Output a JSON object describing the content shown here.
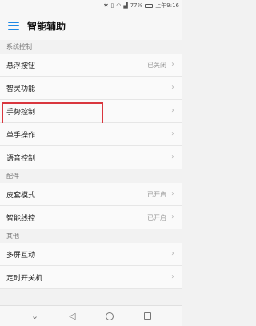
{
  "status_bar": {
    "battery_text": "77%",
    "time": "上午9:16"
  },
  "app_bar": {
    "title": "智能辅助"
  },
  "sections": [
    {
      "header": "系统控制",
      "rows": [
        {
          "label": "悬浮按钮",
          "value": "已关闭"
        },
        {
          "label": "智灵功能",
          "value": ""
        },
        {
          "label": "手势控制",
          "value": ""
        },
        {
          "label": "单手操作",
          "value": ""
        },
        {
          "label": "语音控制",
          "value": ""
        }
      ]
    },
    {
      "header": "配件",
      "rows": [
        {
          "label": "皮套模式",
          "value": "已开启"
        },
        {
          "label": "智能线控",
          "value": "已开启"
        }
      ]
    },
    {
      "header": "其他",
      "rows": [
        {
          "label": "多屏互动",
          "value": ""
        },
        {
          "label": "定时开关机",
          "value": ""
        }
      ]
    }
  ],
  "highlight_color": "#d9363e",
  "accent_color": "#1e88e5",
  "icons": {
    "menu": "menu-icon",
    "chevron": "chevron-right-icon",
    "nav_down": "chevron-down-icon",
    "nav_back": "back-triangle-icon",
    "nav_home": "home-circle-icon",
    "nav_recent": "recent-square-icon"
  }
}
